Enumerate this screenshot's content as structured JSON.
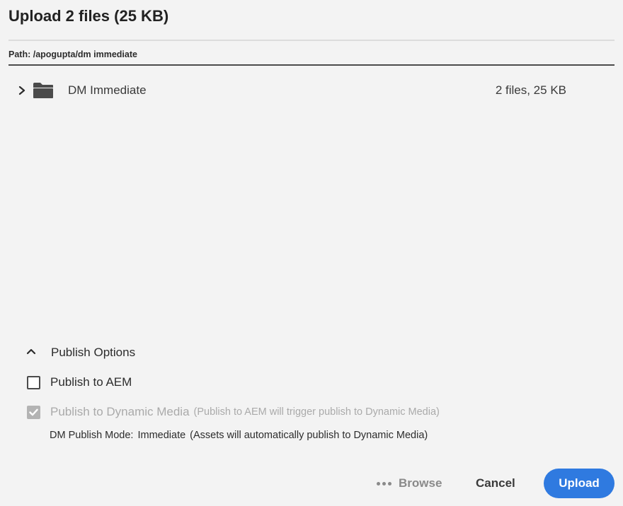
{
  "dialog": {
    "title": "Upload 2 files (25 KB)",
    "path": "Path: /apogupta/dm immediate"
  },
  "folder": {
    "name": "DM Immediate",
    "size": "2 files, 25 KB",
    "icon": "folder-icon",
    "expand_icon": "chevron-right-icon"
  },
  "publish_options": {
    "header": "Publish Options",
    "toggle_icon": "chevron-up-icon",
    "publish_to_aem": {
      "label": "Publish to AEM",
      "checked": false
    },
    "publish_to_dm": {
      "label": "Publish to Dynamic Media",
      "note": "(Publish to AEM will trigger publish to Dynamic Media)",
      "checked": true,
      "disabled": true
    },
    "dm_mode": {
      "label": "DM Publish Mode:",
      "value": "Immediate",
      "note": "(Assets will automatically publish to Dynamic Media)"
    }
  },
  "footer": {
    "browse_label": "Browse",
    "cancel_label": "Cancel",
    "upload_label": "Upload"
  },
  "colors": {
    "accent": "#2f7ae0",
    "background": "#f3f3f3",
    "disabled_text": "#aaaaaa"
  }
}
